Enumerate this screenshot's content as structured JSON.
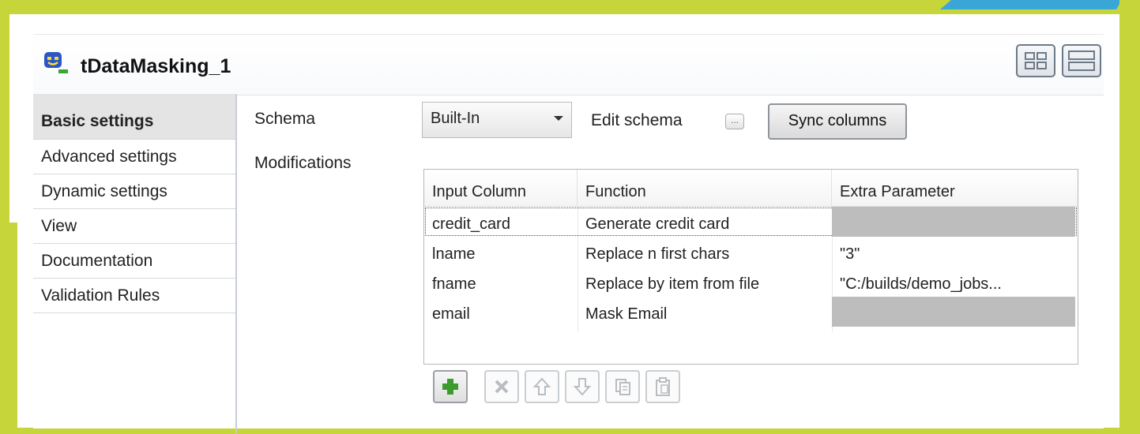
{
  "colors": {
    "frame": "#c6d63a",
    "accent_tab": "#3aa6d8",
    "disabled_cell": "#bdbdbd",
    "add_icon": "#3d9a2f"
  },
  "header": {
    "title": "tDataMasking_1",
    "icon": "mask-component-icon",
    "layout_buttons": [
      "grid-layout-icon",
      "stacked-layout-icon"
    ]
  },
  "sidebar": {
    "items": [
      {
        "label": "Basic settings",
        "active": true
      },
      {
        "label": "Advanced settings",
        "active": false
      },
      {
        "label": "Dynamic settings",
        "active": false
      },
      {
        "label": "View",
        "active": false
      },
      {
        "label": "Documentation",
        "active": false
      },
      {
        "label": "Validation Rules",
        "active": false
      }
    ]
  },
  "form": {
    "schema_label": "Schema",
    "schema_value": "Built-In",
    "edit_schema_label": "Edit schema",
    "edit_schema_button": "...",
    "sync_columns_label": "Sync columns",
    "modifications_label": "Modifications"
  },
  "table": {
    "columns": [
      "Input Column",
      "Function",
      "Extra Parameter"
    ],
    "rows": [
      {
        "input": "credit_card",
        "function": "Generate credit card",
        "extra": "",
        "extra_disabled": true,
        "selected": true
      },
      {
        "input": "lname",
        "function": "Replace n first chars",
        "extra": "\"3\"",
        "extra_disabled": false,
        "selected": false
      },
      {
        "input": "fname",
        "function": "Replace by item from file",
        "extra": "\"C:/builds/demo_jobs...",
        "extra_disabled": false,
        "selected": false
      },
      {
        "input": "email",
        "function": "Mask Email",
        "extra": "",
        "extra_disabled": true,
        "selected": false
      }
    ]
  },
  "toolbar": {
    "buttons": [
      {
        "icon": "add-icon",
        "enabled": true
      },
      {
        "icon": "delete-icon",
        "enabled": false
      },
      {
        "icon": "move-up-icon",
        "enabled": false
      },
      {
        "icon": "move-down-icon",
        "enabled": false
      },
      {
        "icon": "copy-icon",
        "enabled": false
      },
      {
        "icon": "paste-icon",
        "enabled": false
      }
    ]
  }
}
